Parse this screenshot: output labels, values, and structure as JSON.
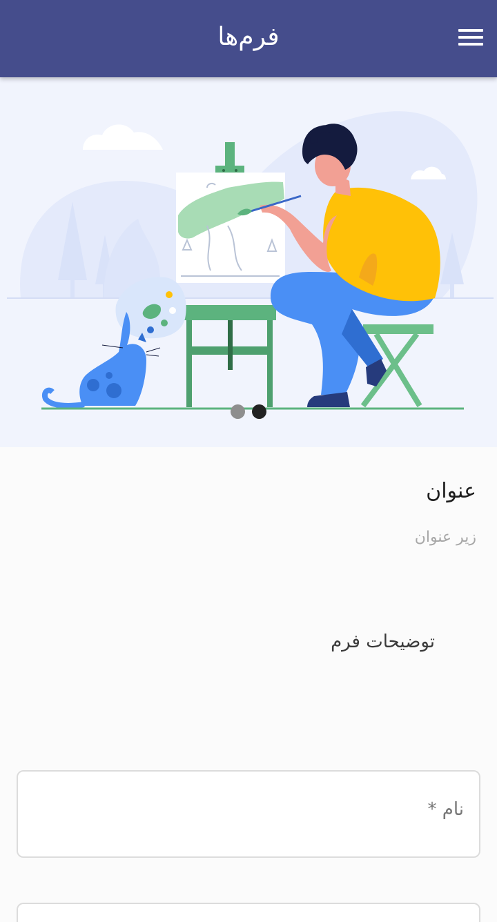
{
  "app_bar": {
    "title": "فرم‌ها",
    "menu_icon": "hamburger-menu-icon"
  },
  "hero": {
    "illustration": "artist-painting-with-cat-illustration",
    "carousel": {
      "total_slides": 2,
      "active_index": 1
    }
  },
  "form": {
    "title": "عنوان",
    "subtitle": "زیر عنوان",
    "description": "توضیحات فرم",
    "fields": [
      {
        "label": "نام *",
        "value": ""
      },
      {
        "label": "",
        "value": ""
      }
    ]
  },
  "colors": {
    "app_bar": "#454d8c",
    "hero_background": "#f1f4fd",
    "shirt": "#ffc107",
    "pants": "#4a8ff5",
    "cat": "#4a8ff5",
    "easel": "#5cb37e"
  }
}
